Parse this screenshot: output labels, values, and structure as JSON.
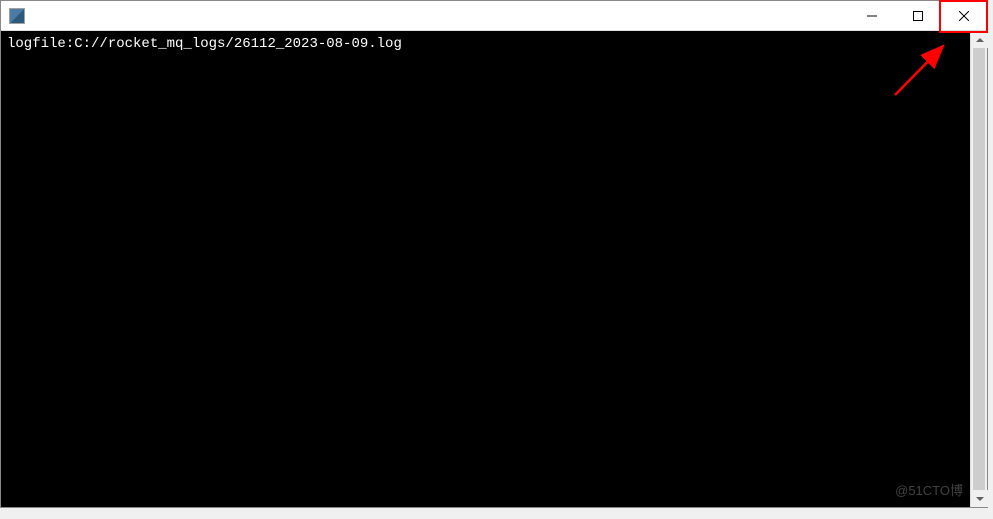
{
  "titlebar": {
    "title": ""
  },
  "console": {
    "line1": "logfile:C://rocket_mq_logs/26112_2023-08-09.log"
  },
  "watermark": {
    "text": "@51CTO博"
  },
  "annotation": {
    "arrow_color": "#ff0000",
    "highlight_color": "#ff0000"
  }
}
